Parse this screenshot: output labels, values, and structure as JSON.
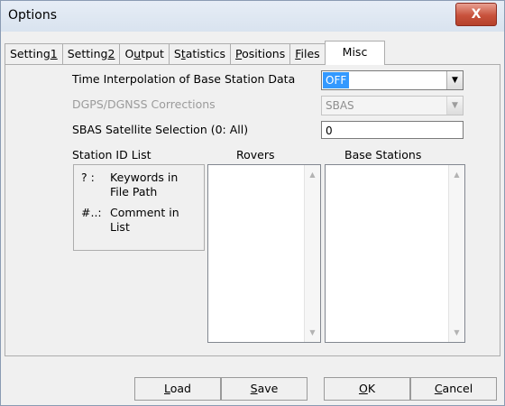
{
  "window": {
    "title": "Options",
    "close_symbol": "X"
  },
  "tabs": [
    {
      "pre": "Setting",
      "key": "1",
      "post": ""
    },
    {
      "pre": "Setting",
      "key": "2",
      "post": ""
    },
    {
      "pre": "O",
      "key": "u",
      "post": "tput"
    },
    {
      "pre": "S",
      "key": "t",
      "post": "atistics"
    },
    {
      "pre": "",
      "key": "P",
      "post": "ositions"
    },
    {
      "pre": "",
      "key": "F",
      "post": "iles"
    },
    {
      "pre": "Misc",
      "key": "",
      "post": ""
    }
  ],
  "active_tab": "Misc",
  "misc": {
    "time_interp_label": "Time Interpolation of Base Station Data",
    "time_interp_value": "OFF",
    "dgps_label": "DGPS/DGNSS Corrections",
    "dgps_value": "SBAS",
    "sbas_label": "SBAS Satellite Selection (0: All)",
    "sbas_value": "0",
    "station_id_label": "Station ID List",
    "rovers_label": "Rovers",
    "base_stations_label": "Base Stations",
    "hint_q_sym": "? :",
    "hint_q_text_1": "Keywords in",
    "hint_q_text_2": "File Path",
    "hint_hash_sym": "#..:",
    "hint_hash_text_1": "Comment in",
    "hint_hash_text_2": "List"
  },
  "buttons": {
    "load": {
      "key": "L",
      "post": "oad"
    },
    "save": {
      "key": "S",
      "post": "ave"
    },
    "ok": {
      "key": "O",
      "post": "K"
    },
    "cancel": {
      "key": "C",
      "post": "ancel"
    }
  },
  "icons": {
    "dropdown": "chevron-down-icon",
    "scroll_up": "scroll-up-arrow-icon",
    "scroll_down": "scroll-down-arrow-icon",
    "close": "close-icon"
  }
}
